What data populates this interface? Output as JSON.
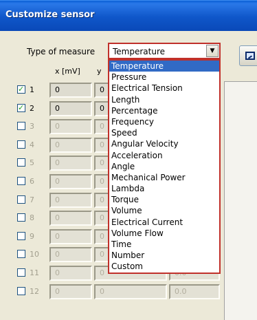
{
  "window": {
    "title": "Customize sensor"
  },
  "form": {
    "type_label": "Type of measure",
    "selected_type": "Temperature",
    "combo_arrow": "▼",
    "col_x": "x [mV]",
    "col_y": "y"
  },
  "dropdown": {
    "options": [
      "Temperature",
      "Pressure",
      "Electrical Tension",
      "Length",
      "Percentage",
      "Frequency",
      "Speed",
      "Angular Velocity",
      "Acceleration",
      "Angle",
      "Mechanical Power",
      "Lambda",
      "Torque",
      "Volume",
      "Electrical Current",
      "Volume Flow",
      "Time",
      "Number",
      "Custom"
    ],
    "selected_index": 0
  },
  "rows": [
    {
      "label": "1",
      "checked": true,
      "x": "0",
      "y": "0"
    },
    {
      "label": "2",
      "checked": true,
      "x": "0",
      "y": "0"
    },
    {
      "label": "3",
      "checked": false,
      "x": "0",
      "y": "0"
    },
    {
      "label": "4",
      "checked": false,
      "x": "0",
      "y": "0"
    },
    {
      "label": "5",
      "checked": false,
      "x": "0",
      "y": "0"
    },
    {
      "label": "6",
      "checked": false,
      "x": "0",
      "y": "0"
    },
    {
      "label": "7",
      "checked": false,
      "x": "0",
      "y": "0"
    },
    {
      "label": "8",
      "checked": false,
      "x": "0",
      "y": "0"
    },
    {
      "label": "9",
      "checked": false,
      "x": "0",
      "y": "0"
    },
    {
      "label": "10",
      "checked": false,
      "x": "0",
      "y": "0"
    },
    {
      "label": "11",
      "checked": false,
      "x": "0",
      "y": "0",
      "z": "0.0"
    },
    {
      "label": "12",
      "checked": false,
      "x": "0",
      "y": "0",
      "z": "0.0"
    }
  ],
  "icons": {
    "chart_button": "chart-icon"
  }
}
